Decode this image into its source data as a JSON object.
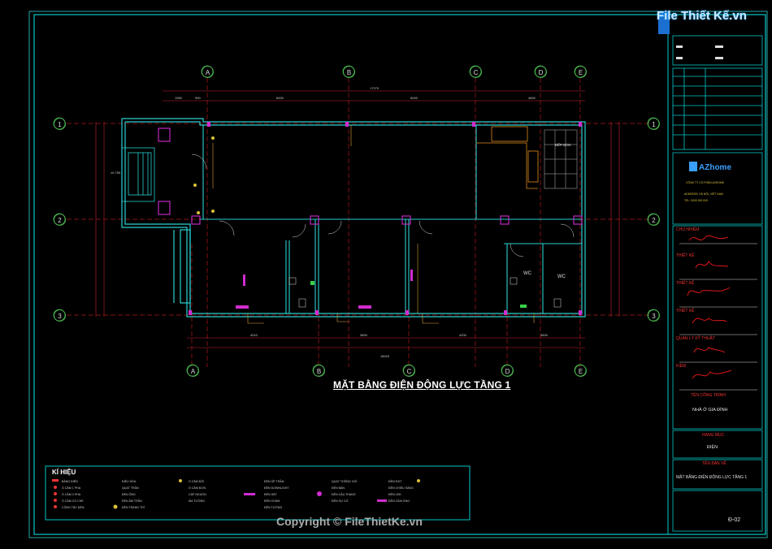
{
  "drawing": {
    "title": "MẶT BẰNG ĐIỆN ĐỘNG LỰC TẦNG 1",
    "grid_top": [
      "A",
      "B",
      "C",
      "D",
      "E"
    ],
    "grid_bottom": [
      "A",
      "B",
      "C",
      "D",
      "E"
    ],
    "grid_side": [
      "1",
      "2",
      "3"
    ],
    "room_labels": {
      "wc1": "WC",
      "wc2": "WC",
      "kitchen": "BẾP BÀN"
    }
  },
  "legend": {
    "title": "KÍ HIỆU"
  },
  "title_block": {
    "logo_text": "AZhome",
    "roles": [
      "CHỦ NHIỆM",
      "THIẾT KẾ",
      "THIẾT KẾ",
      "THIẾT KẾ",
      "QUẢN LÝ KỸ THUẬT",
      "KIỂM"
    ],
    "project_label": "TÊN CÔNG TRÌNH",
    "project_value": "NHÀ Ở GIA ĐÌNH",
    "category_label": "HẠNG MỤC",
    "category_value": "ĐIỆN",
    "sheet_label": "TÊN BẢN VẼ",
    "sheet_value": "MẶT BẰNG ĐIỆN ĐỘNG LỰC TẦNG 1",
    "sheet_no": "Đ-02"
  },
  "watermark": {
    "brand": "File Thiết Kế.vn",
    "copyright": "Copyright © FileThietKe.vn"
  }
}
